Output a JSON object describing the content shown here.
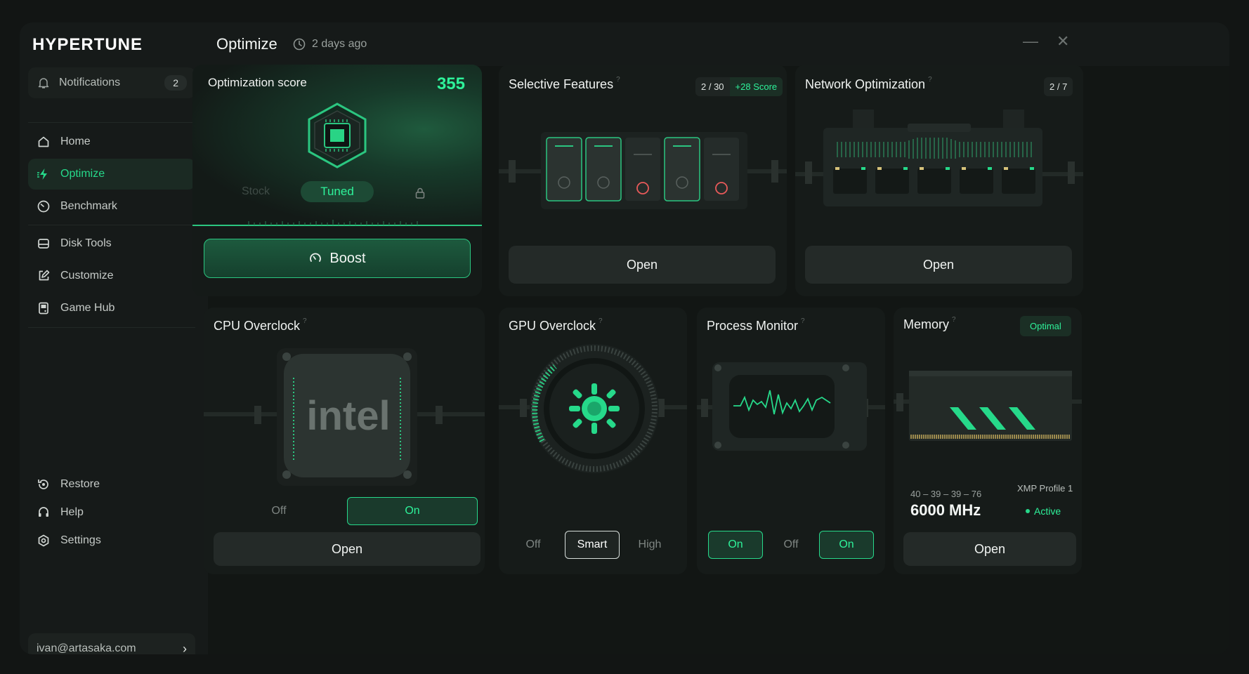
{
  "app": {
    "brand": "HYPERTUNE",
    "page_title": "Optimize",
    "last_run": "2 days ago"
  },
  "sidebar": {
    "notifications": {
      "label": "Notifications",
      "count": "2"
    },
    "items": [
      {
        "label": "Home",
        "icon": "home-icon"
      },
      {
        "label": "Optimize",
        "icon": "lightning-icon",
        "active": true
      },
      {
        "label": "Benchmark",
        "icon": "gauge-icon"
      },
      {
        "label": "Disk Tools",
        "icon": "disk-icon"
      },
      {
        "label": "Customize",
        "icon": "edit-icon"
      },
      {
        "label": "Game Hub",
        "icon": "gamepad-icon"
      },
      {
        "label": "Restore",
        "icon": "restore-icon"
      },
      {
        "label": "Help",
        "icon": "headset-icon"
      },
      {
        "label": "Settings",
        "icon": "gear-icon"
      }
    ],
    "user_email": "ivan@artasaka.com"
  },
  "score_card": {
    "title": "Optimization score",
    "score": "355",
    "mode_stock": "Stock",
    "mode_tuned": "Tuned",
    "boost_label": "Boost"
  },
  "selective_features": {
    "title": "Selective Features",
    "count": "2 / 30",
    "bonus": "+28 Score",
    "open_label": "Open"
  },
  "network": {
    "title": "Network Optimization",
    "count": "2 / 7",
    "open_label": "Open"
  },
  "cpu": {
    "title": "CPU Overclock",
    "brand_text": "intel",
    "off_label": "Off",
    "on_label": "On",
    "open_label": "Open"
  },
  "gpu": {
    "title": "GPU Overclock",
    "off_label": "Off",
    "smart_label": "Smart",
    "high_label": "High"
  },
  "process": {
    "title": "Process Monitor",
    "on_label": "On",
    "off_label": "Off",
    "on2_label": "On"
  },
  "memory": {
    "title": "Memory",
    "status": "Optimal",
    "timings": "40 – 39 – 39 – 76",
    "frequency": "6000 MHz",
    "xmp": "XMP Profile 1",
    "xmp_status": "Active",
    "open_label": "Open"
  },
  "colors": {
    "accent": "#26d98a",
    "bg": "#161a19",
    "card": "#161b19",
    "red": "#e85a5a"
  }
}
